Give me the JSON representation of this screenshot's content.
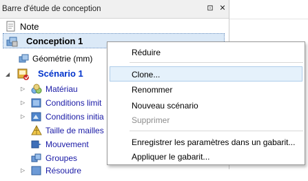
{
  "panel": {
    "title": "Barre d'étude de conception",
    "pin_label": "⊡",
    "close_label": "✕"
  },
  "tree": {
    "note": "Note",
    "design": "Conception 1",
    "geometry": "Géométrie (mm)",
    "scenario": "Scénario 1",
    "material": "Matériau",
    "boundary_conditions": "Conditions limit",
    "initial_conditions": "Conditions initia",
    "mesh_size": "Taille de mailles",
    "motion": "Mouvement",
    "groups": "Groupes",
    "solve": "Résoudre"
  },
  "menu": {
    "reduce": "Réduire",
    "clone": "Clone...",
    "rename": "Renommer",
    "new_scenario": "Nouveau scénario",
    "delete": "Supprimer",
    "save_template": "Enregistrer les paramètres dans un gabarit...",
    "apply_template": "Appliquer le gabarit..."
  },
  "colors": {
    "accent": "#0033cc",
    "selection": "#dbe9f7",
    "menu_hover": "#e5f1fb"
  }
}
